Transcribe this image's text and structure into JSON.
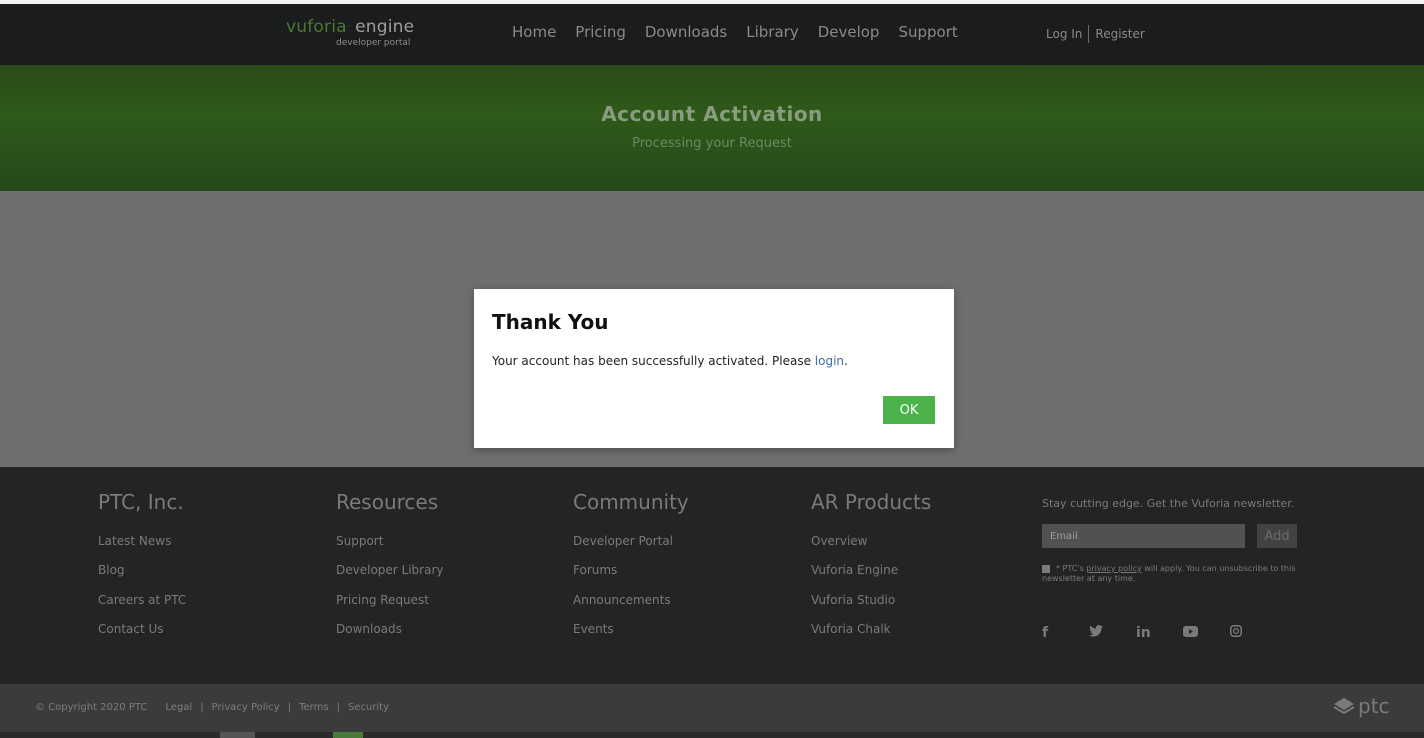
{
  "header": {
    "logo_vuforia": "vuforia",
    "logo_engine": "engine",
    "logo_sub": "developer portal",
    "nav": [
      "Home",
      "Pricing",
      "Downloads",
      "Library",
      "Develop",
      "Support"
    ],
    "login": "Log In",
    "register": "Register"
  },
  "hero": {
    "title": "Account Activation",
    "subtitle": "Processing your Request"
  },
  "modal": {
    "title": "Thank You",
    "message_prefix": "Your account has been successfully activated. Please ",
    "message_link": "login",
    "message_suffix": ".",
    "ok_label": "OK"
  },
  "footer": {
    "columns": [
      {
        "title": "PTC, Inc.",
        "links": [
          "Latest News",
          "Blog",
          "Careers at PTC",
          "Contact Us"
        ]
      },
      {
        "title": "Resources",
        "links": [
          "Support",
          "Developer Library",
          "Pricing Request",
          "Downloads"
        ]
      },
      {
        "title": "Community",
        "links": [
          "Developer Portal",
          "Forums",
          "Announcements",
          "Events"
        ]
      },
      {
        "title": "AR Products",
        "links": [
          "Overview",
          "Vuforia Engine",
          "Vuforia Studio",
          "Vuforia Chalk"
        ]
      }
    ],
    "newsletter": {
      "text": "Stay cutting edge. Get the Vuforia newsletter.",
      "email_placeholder": "Email",
      "add_label": "Add",
      "consent_prefix": "* PTC's ",
      "consent_link": "privacy policy",
      "consent_suffix": " will apply. You can unsubscribe to this newsletter at any time."
    },
    "social_icons": [
      "facebook-icon",
      "twitter-icon",
      "linkedin-icon",
      "youtube-icon",
      "instagram-icon"
    ]
  },
  "bottombar": {
    "copyright": "© Copyright 2020 PTC",
    "links": [
      "Legal",
      "Privacy Policy",
      "Terms",
      "Security"
    ],
    "brand": "ptc"
  },
  "colors": {
    "accent_green": "#4bb34a",
    "hero_green": "#2f5a1a",
    "link_blue": "#3b6ea8"
  }
}
